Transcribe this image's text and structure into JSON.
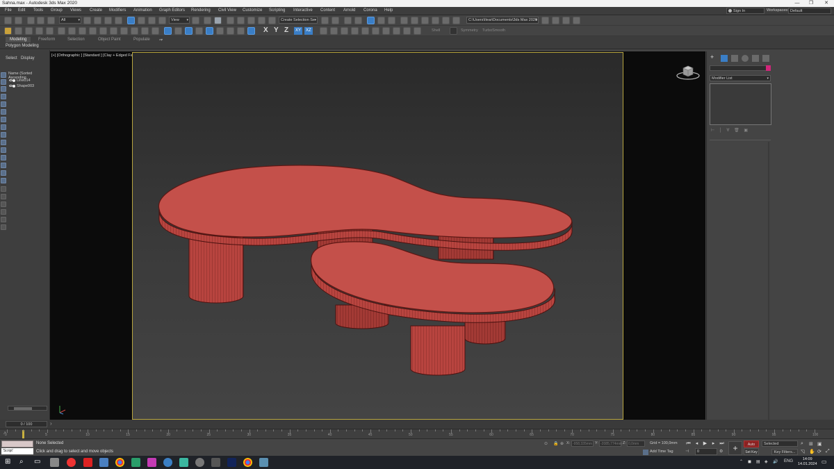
{
  "window": {
    "title": "Sahna.max - Autodesk 3ds Max 2020",
    "controls": [
      "—",
      "❐",
      "✕"
    ]
  },
  "menubar": {
    "items": [
      "File",
      "Edit",
      "Tools",
      "Group",
      "Views",
      "Create",
      "Modifiers",
      "Animation",
      "Graph Editors",
      "Rendering",
      "Civil View",
      "Customize",
      "Scripting",
      "Interactive",
      "Content",
      "Arnold",
      "Corona",
      "Help"
    ],
    "signin_label": "Sign In",
    "workspaces_label": "Workspaces:",
    "workspace_value": "Default"
  },
  "toolbar": {
    "filter_value": "All",
    "refcoord_value": "View",
    "selection_set_placeholder": "Create Selection Se",
    "project_path": "C:\\Users\\Ilear\\Documents\\3ds Max 2020",
    "axis_x": "X",
    "axis_y": "Y",
    "axis_z": "Z",
    "axis_xy": "XY",
    "axis_xz": "XZ",
    "shell_label": "Shell",
    "symmetry_label": "Symmetry",
    "turbosmooth_label": "TurboSmooth"
  },
  "ribbon": {
    "tabs": [
      "Modeling",
      "Freeform",
      "Selection",
      "Object Paint",
      "Populate"
    ],
    "extra": "▪▾",
    "sub_label": "Polygon Modeling"
  },
  "explorer": {
    "tabs": [
      "Select",
      "Display"
    ],
    "header": "Name (Sorted Ascending",
    "nodes": [
      "Line014",
      "Shape003"
    ]
  },
  "viewport": {
    "label": "[+] [Orthographic ] [Standard ] [Clay + Edged Faces ]",
    "table_color": "#c4504a",
    "edge_color": "#8e2c28"
  },
  "command_panel": {
    "modifier_list": "Modifier List",
    "accent_swatch": "#d1267a"
  },
  "timeline": {
    "frame_display": "0 / 100",
    "ticks": [
      "0",
      "5",
      "10",
      "15",
      "20",
      "25",
      "30",
      "35",
      "40",
      "45",
      "50",
      "55",
      "60",
      "65",
      "70",
      "75",
      "80",
      "85",
      "90",
      "95",
      "100"
    ]
  },
  "status": {
    "maxscript_hint": "'Script'",
    "none_selected": "None Selected",
    "hint": "Click and drag to select and move objects",
    "x_label": "X:",
    "y_label": "Y:",
    "z_label": "Z:",
    "x_val": "-958,335mm",
    "y_val": "-2085,774mm",
    "z_val": "0,0mm",
    "grid": "Grid = 100,0mm",
    "add_time_tag": "Add Time Tag",
    "auto_key": "Auto Key",
    "set_key": "Set Key",
    "selected": "Selected",
    "key_filters": "Key Filters...",
    "frame": "0"
  },
  "taskbar": {
    "lang": "ENG",
    "time": "14:09",
    "date": "14.01.2024"
  }
}
